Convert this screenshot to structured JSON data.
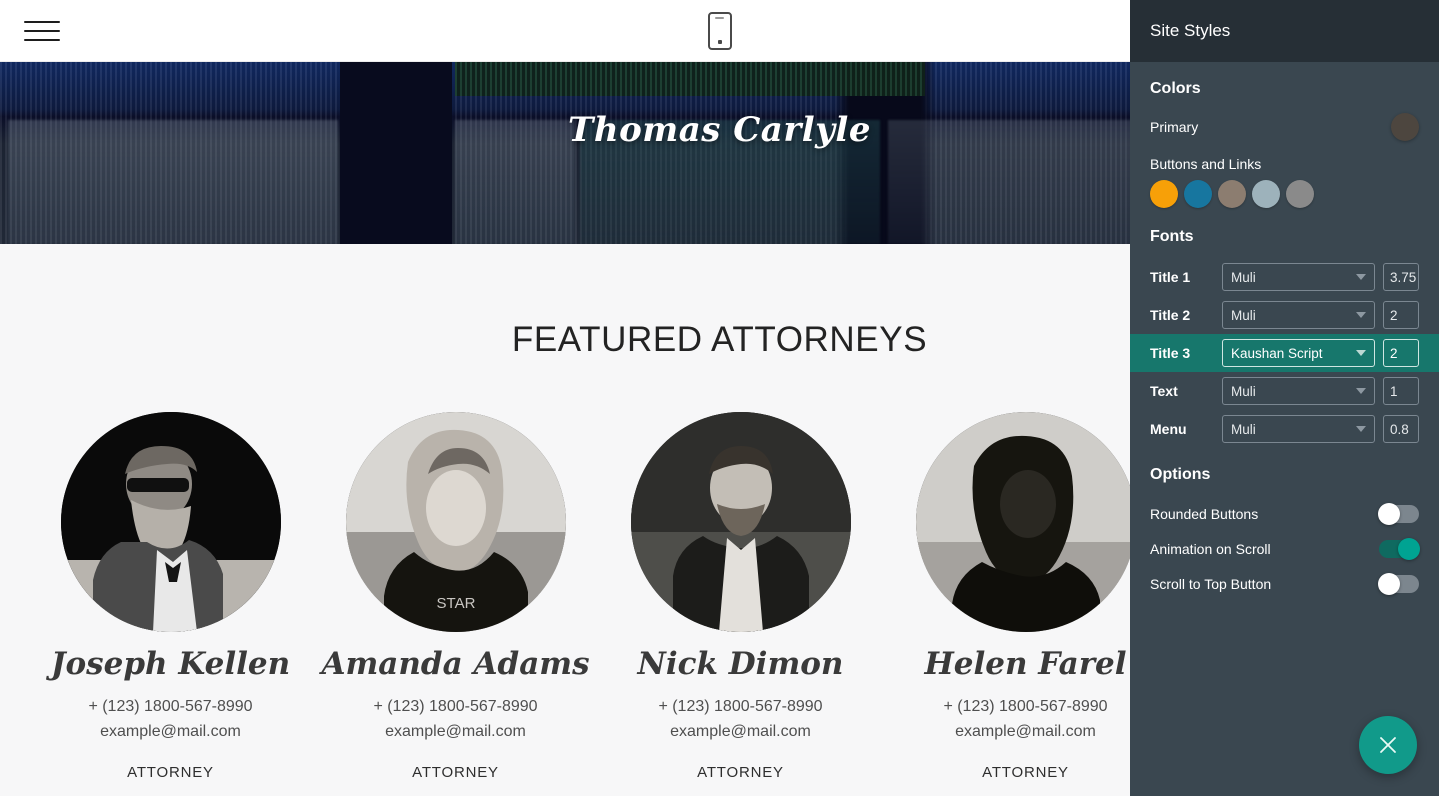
{
  "navbar": {
    "menu_icon": "hamburger-menu-icon",
    "device_icon": "mobile-device-icon"
  },
  "hero": {
    "title": "Thomas Carlyle"
  },
  "section": {
    "title": "FEATURED ATTORNEYS",
    "attorneys": [
      {
        "name": "Joseph Kellen",
        "phone": "+ (123) 1800-567-8990",
        "email": "example@mail.com",
        "role": "ATTORNEY"
      },
      {
        "name": "Amanda Adams",
        "phone": "+ (123) 1800-567-8990",
        "email": "example@mail.com",
        "role": "ATTORNEY"
      },
      {
        "name": "Nick Dimon",
        "phone": "+ (123) 1800-567-8990",
        "email": "example@mail.com",
        "role": "ATTORNEY"
      },
      {
        "name": "Helen Farel",
        "phone": "+ (123) 1800-567-8990",
        "email": "example@mail.com",
        "role": "ATTORNEY"
      }
    ]
  },
  "panel": {
    "header_title": "Site Styles",
    "colors": {
      "group_title": "Colors",
      "primary_label": "Primary",
      "primary_color": "#4d463f",
      "buttons_links_label": "Buttons and Links",
      "palette": [
        "#f7a008",
        "#17769f",
        "#8c7d70",
        "#9db2bb",
        "#8a8a8a"
      ]
    },
    "fonts": {
      "group_title": "Fonts",
      "rows": [
        {
          "label": "Title 1",
          "font": "Muli",
          "size": "3.75",
          "active": false
        },
        {
          "label": "Title 2",
          "font": "Muli",
          "size": "2",
          "active": false
        },
        {
          "label": "Title 3",
          "font": "Kaushan Script",
          "size": "2",
          "active": true
        },
        {
          "label": "Text",
          "font": "Muli",
          "size": "1",
          "active": false
        },
        {
          "label": "Menu",
          "font": "Muli",
          "size": "0.8",
          "active": false
        }
      ]
    },
    "options": {
      "group_title": "Options",
      "rows": [
        {
          "label": "Rounded Buttons",
          "on": false
        },
        {
          "label": "Animation on Scroll",
          "on": true
        },
        {
          "label": "Scroll to Top Button",
          "on": false
        }
      ]
    },
    "accent_color": "#17776c",
    "close_button_icon": "close-x-icon",
    "close_button_color": "#119a8a"
  }
}
